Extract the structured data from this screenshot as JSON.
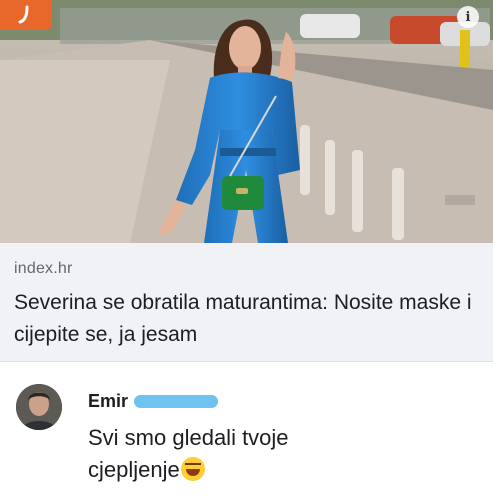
{
  "article": {
    "source": "index.hr",
    "headline": "Severina se obratila maturantima: Nosite maske i cijepite se, ja jesam"
  },
  "comment": {
    "author": "Emir",
    "text": "Svi smo gledali tvoje cjepljenje"
  },
  "icons": {
    "app_badge": "app-logo-icon",
    "info": "info-icon",
    "emoji": "laughing-tears-emoji-icon"
  },
  "colors": {
    "app_badge": "#e8672b",
    "preview_bg": "#f0f2f5",
    "redaction": "#6fc3f0"
  }
}
